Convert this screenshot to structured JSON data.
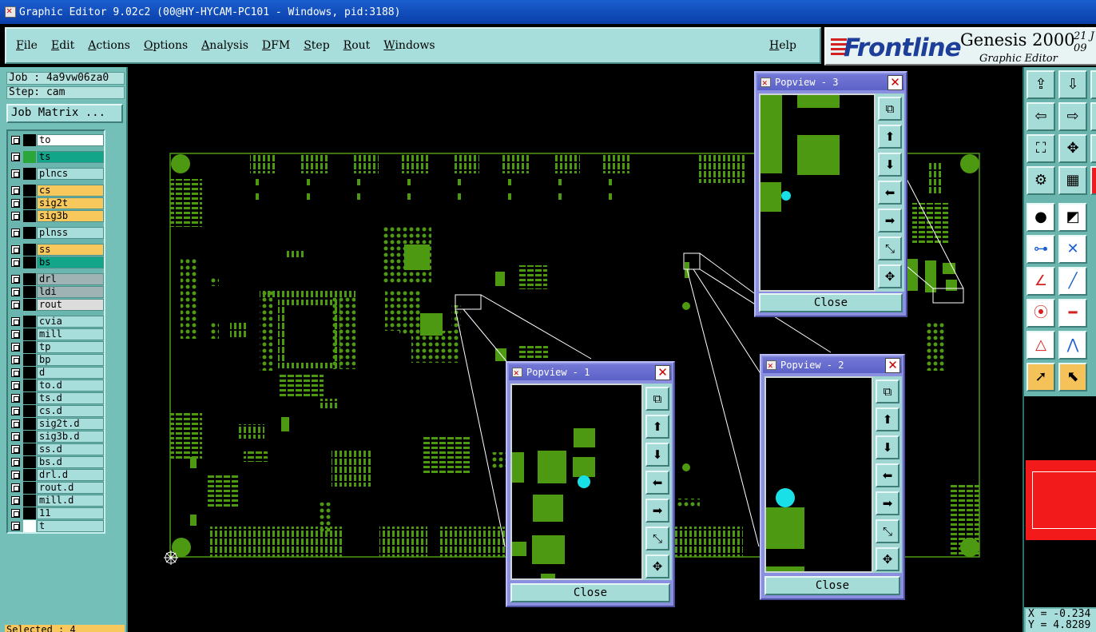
{
  "window": {
    "title": "Graphic Editor 9.02c2 (00@HY-HYCAM-PC101 - Windows, pid:3188)"
  },
  "menu": {
    "items": [
      "File",
      "Edit",
      "Actions",
      "Options",
      "Analysis",
      "DFM",
      "Step",
      "Rout",
      "Windows"
    ],
    "help": "Help"
  },
  "logo": {
    "brand": "Frontline",
    "product": "Genesis 2000",
    "subtitle": "Graphic Editor",
    "date_line1": "21 J",
    "date_line2": "09"
  },
  "left_panel": {
    "job": "Job : 4a9vw06za0",
    "step": "Step: cam",
    "job_matrix": "Job Matrix ...",
    "selected": "Selected : 4",
    "layers": [
      {
        "name": "to",
        "swatch": "#000000",
        "bg": "#ffffff"
      },
      {
        "name": "ts",
        "swatch": "#2aa63a",
        "bg": "#13a58a"
      },
      {
        "name": "plncs",
        "swatch": "#000000",
        "bg": "#a7dedc"
      },
      {
        "name": "cs",
        "swatch": "#000000",
        "bg": "#f8c85c"
      },
      {
        "name": "sig2t",
        "swatch": "#000000",
        "bg": "#f8c85c"
      },
      {
        "name": "sig3b",
        "swatch": "#000000",
        "bg": "#f8c85c"
      },
      {
        "name": "plnss",
        "swatch": "#000000",
        "bg": "#a7dedc"
      },
      {
        "name": "ss",
        "swatch": "#000000",
        "bg": "#f8c85c"
      },
      {
        "name": "bs",
        "swatch": "#000000",
        "bg": "#13a58a"
      },
      {
        "name": "drl",
        "swatch": "#000000",
        "bg": "#9fb3b5"
      },
      {
        "name": "ldi",
        "swatch": "#000000",
        "bg": "#9fb3b5"
      },
      {
        "name": "rout",
        "swatch": "#000000",
        "bg": "#dcdcdc"
      },
      {
        "name": "cvia",
        "swatch": "#000000",
        "bg": "#a7dedc"
      },
      {
        "name": "mill",
        "swatch": "#000000",
        "bg": "#a7dedc"
      },
      {
        "name": "tp",
        "swatch": "#000000",
        "bg": "#a7dedc"
      },
      {
        "name": "bp",
        "swatch": "#000000",
        "bg": "#a7dedc"
      },
      {
        "name": "d",
        "swatch": "#000000",
        "bg": "#a7dedc"
      },
      {
        "name": "to.d",
        "swatch": "#000000",
        "bg": "#a7dedc"
      },
      {
        "name": "ts.d",
        "swatch": "#000000",
        "bg": "#a7dedc"
      },
      {
        "name": "cs.d",
        "swatch": "#000000",
        "bg": "#a7dedc"
      },
      {
        "name": "sig2t.d",
        "swatch": "#000000",
        "bg": "#a7dedc"
      },
      {
        "name": "sig3b.d",
        "swatch": "#000000",
        "bg": "#a7dedc"
      },
      {
        "name": "ss.d",
        "swatch": "#000000",
        "bg": "#a7dedc"
      },
      {
        "name": "bs.d",
        "swatch": "#000000",
        "bg": "#a7dedc"
      },
      {
        "name": "drl.d",
        "swatch": "#000000",
        "bg": "#a7dedc"
      },
      {
        "name": "rout.d",
        "swatch": "#000000",
        "bg": "#a7dedc"
      },
      {
        "name": "mill.d",
        "swatch": "#000000",
        "bg": "#a7dedc"
      },
      {
        "name": "11",
        "swatch": "#000000",
        "bg": "#a7dedc"
      },
      {
        "name": "t",
        "swatch": "#ffffff",
        "bg": "#a7dedc"
      }
    ]
  },
  "popviews": [
    {
      "title": "Popview - 1",
      "close": "Close"
    },
    {
      "title": "Popview - 2",
      "close": "Close"
    },
    {
      "title": "Popview - 3",
      "close": "Close"
    }
  ],
  "status": {
    "x": "X = -0.234",
    "y": "Y = 4.8289"
  },
  "colors": {
    "pcb_green": "#4d9a12",
    "highlight_cyan": "#19e0e6",
    "panel_teal": "#74c0b8"
  }
}
